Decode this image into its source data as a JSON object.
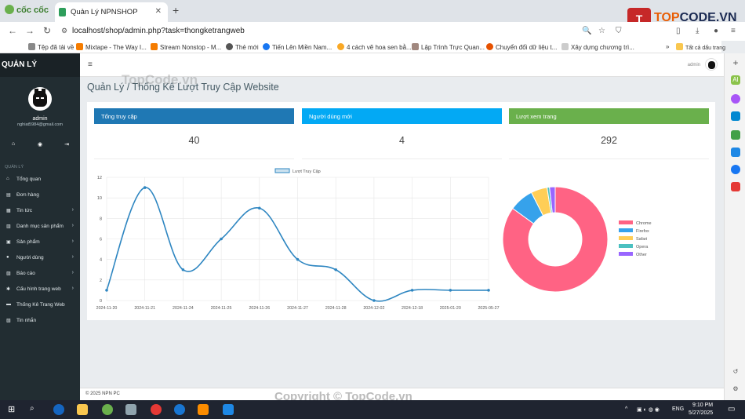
{
  "browser": {
    "brand": "cốc cốc",
    "tab_title": "Quản Lý NPNSHOP",
    "url": "localhost/shop/admin.php?task=thongketrangweb",
    "bookmarks": [
      "Tệp đã tải về",
      "Mixtape - The Way I...",
      "Stream Nonstop - M...",
      "Thẻ mới",
      "Tiến Lên Miền Nam...",
      "4 cách vẽ hoa sen bằ...",
      "Lập Trình Trực Quan...",
      "Chuyển đổi dữ liệu t...",
      "Xây dựng chương trì..."
    ],
    "all_bookmarks": "Tất cả dấu trang"
  },
  "logo": {
    "box": "T",
    "name_a": "TOP",
    "name_b": "CODE.VN"
  },
  "sidebar": {
    "header": "QUẢN LÝ",
    "user_name": "admin",
    "user_email": "nghiat5984@gmail.com",
    "section_label": "QUẢN LÝ",
    "items": [
      {
        "label": "Tổng quan",
        "icon": "home-icon",
        "has_children": false
      },
      {
        "label": "Đơn hàng",
        "icon": "order-icon",
        "has_children": false
      },
      {
        "label": "Tin tức",
        "icon": "news-icon",
        "has_children": true
      },
      {
        "label": "Danh mục sản phẩm",
        "icon": "category-icon",
        "has_children": true
      },
      {
        "label": "Sản phẩm",
        "icon": "product-icon",
        "has_children": true
      },
      {
        "label": "Người dùng",
        "icon": "user-icon",
        "has_children": true
      },
      {
        "label": "Báo cáo",
        "icon": "report-icon",
        "has_children": true
      },
      {
        "label": "Cấu hình trang web",
        "icon": "settings-icon",
        "has_children": true
      },
      {
        "label": "Thống Kê Trang Web",
        "icon": "stats-icon",
        "has_children": false
      },
      {
        "label": "Tin nhắn",
        "icon": "message-icon",
        "has_children": false
      }
    ]
  },
  "header": {
    "admin_label": "admin"
  },
  "main": {
    "watermark": "TopCode.vn",
    "title": "Quản Lý / Thống Kê Lượt Truy Cập Website",
    "stats": [
      {
        "label": "Tổng truy cập",
        "value": "40",
        "color": "#1f78b4"
      },
      {
        "label": "Người dùng mới",
        "value": "4",
        "color": "#03a9f4"
      },
      {
        "label": "Lượt xem trang",
        "value": "292",
        "color": "#6ab04c"
      }
    ]
  },
  "chart_data": [
    {
      "type": "line",
      "legend": [
        "Lượt Truy Cập"
      ],
      "categories": [
        "2024-11-20",
        "2024-11-21",
        "2024-11-24",
        "2024-11-25",
        "2024-11-26",
        "2024-11-27",
        "2024-11-28",
        "2024-12-02",
        "2024-12-18",
        "2025-01-20",
        "2025-05-27"
      ],
      "series": [
        {
          "name": "Lượt Truy Cập",
          "values": [
            1,
            11,
            3,
            6,
            9,
            4,
            3,
            0,
            1,
            1,
            1
          ]
        }
      ],
      "ylim": [
        0,
        12
      ],
      "yticks": [
        0,
        2,
        4,
        6,
        8,
        10,
        12
      ],
      "color": "#2e86c1",
      "grid": true
    },
    {
      "type": "pie",
      "categories": [
        "Chrome",
        "Firefox",
        "Safari",
        "Opera",
        "Other"
      ],
      "values": [
        34,
        3,
        2,
        0.3,
        0.7
      ],
      "colors": [
        "#ff6384",
        "#36a2eb",
        "#ffce56",
        "#4bc0c0",
        "#9966ff"
      ],
      "legend_position": "right"
    }
  ],
  "footer": {
    "text": "© 2025 NPN PC",
    "copyright": "Copyright © TopCode.vn"
  },
  "taskbar": {
    "lang": "ENG",
    "time": "9:10 PM",
    "date": "5/27/2025"
  }
}
